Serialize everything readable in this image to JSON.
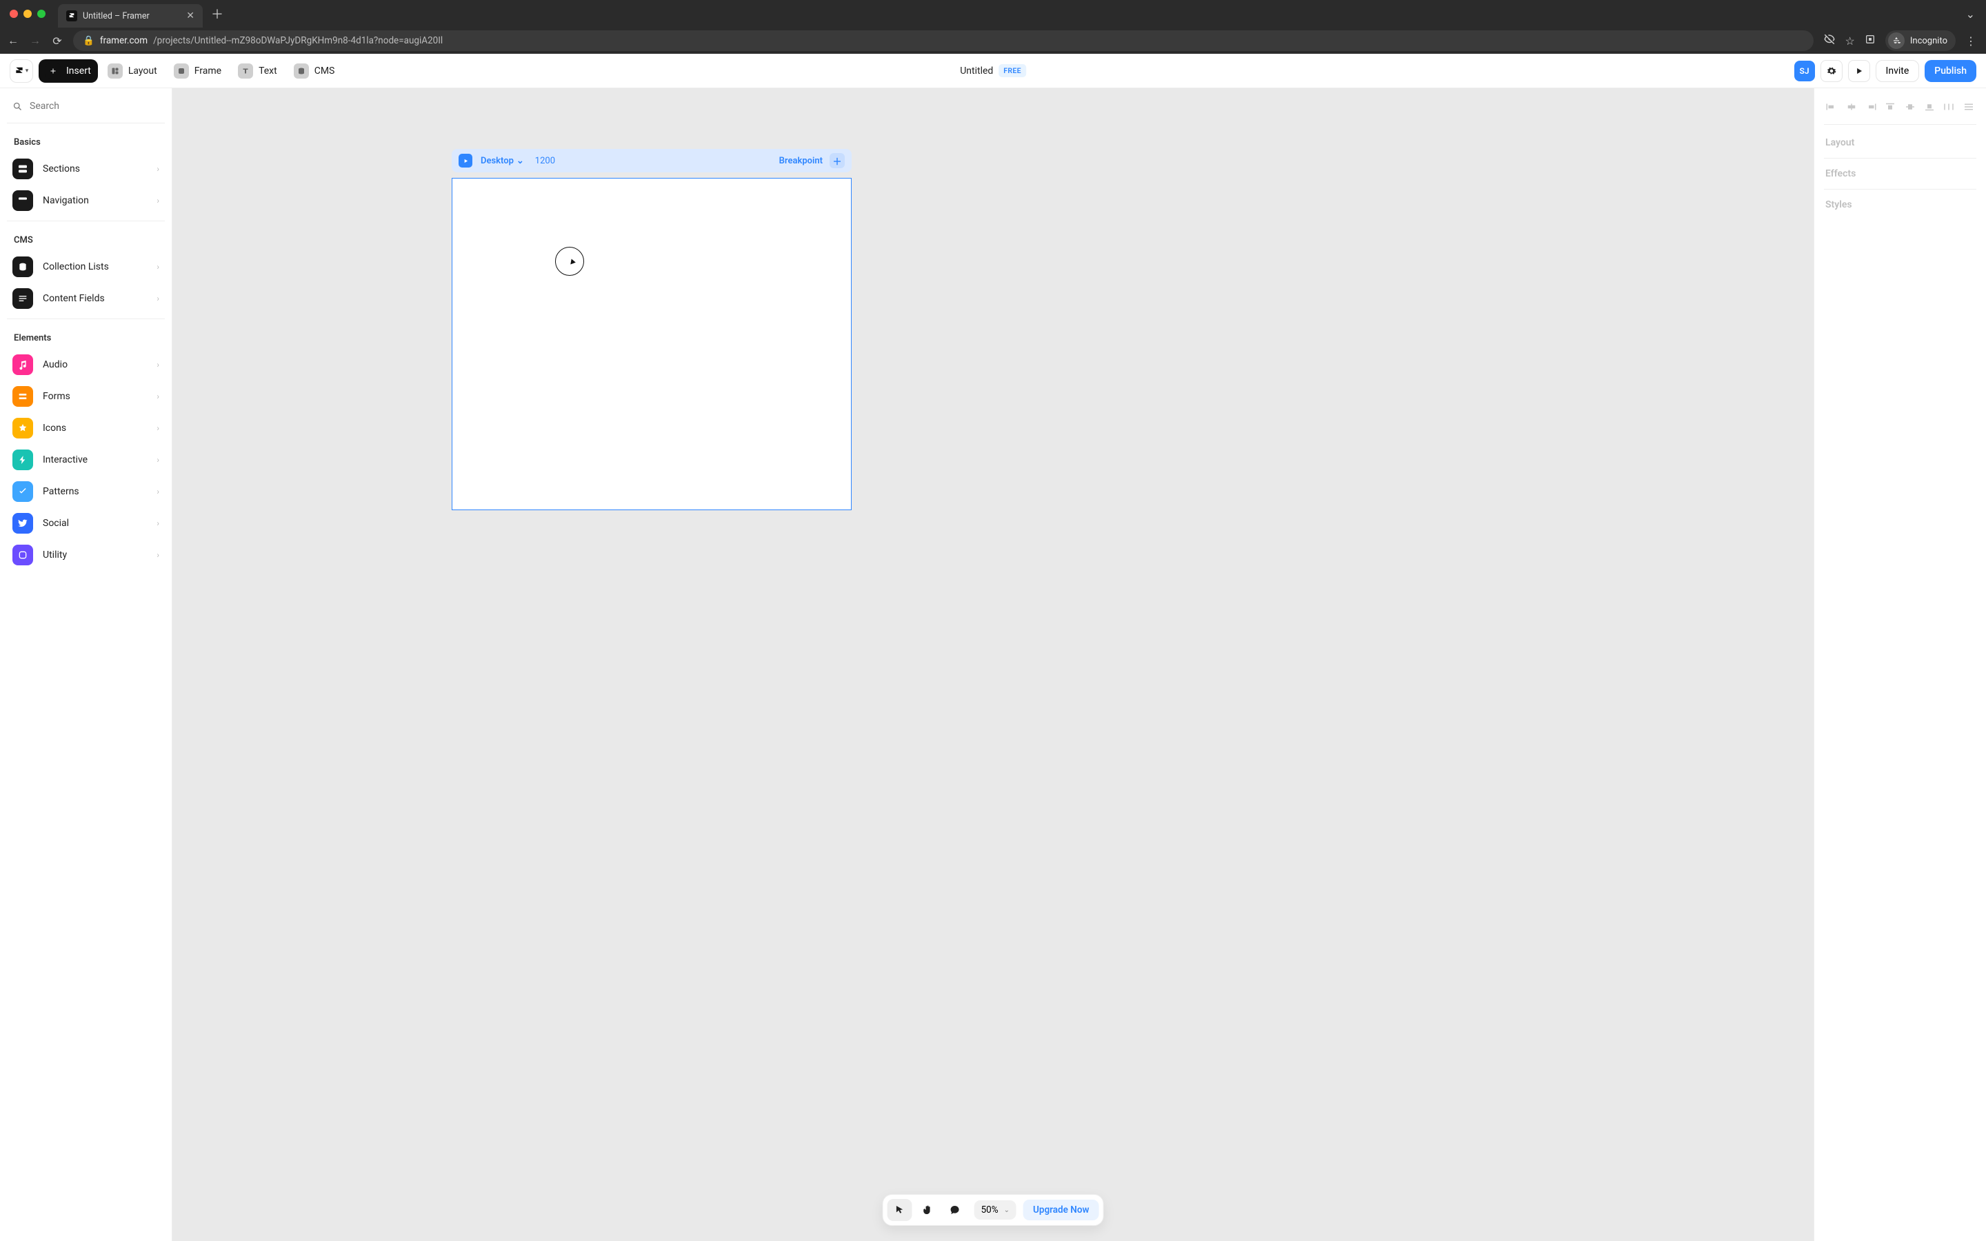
{
  "browser": {
    "tab_title": "Untitled – Framer",
    "url_domain": "framer.com",
    "url_path": "/projects/Untitled--mZ98oDWaPJyDRgKHm9n8-4d1la?node=augiA20Il",
    "incognito_label": "Incognito"
  },
  "toolbar": {
    "insert": "Insert",
    "layout": "Layout",
    "frame": "Frame",
    "text": "Text",
    "cms": "CMS",
    "project_title": "Untitled",
    "plan_badge": "FREE",
    "user_initials": "SJ",
    "invite": "Invite",
    "publish": "Publish"
  },
  "left": {
    "search_placeholder": "Search",
    "sections": {
      "basics": {
        "label": "Basics",
        "items": [
          "Sections",
          "Navigation"
        ]
      },
      "cms": {
        "label": "CMS",
        "items": [
          "Collection Lists",
          "Content Fields"
        ]
      },
      "elements": {
        "label": "Elements",
        "items": [
          "Audio",
          "Forms",
          "Icons",
          "Interactive",
          "Patterns",
          "Social",
          "Utility"
        ]
      }
    }
  },
  "canvas": {
    "breakpoint_name": "Desktop",
    "breakpoint_width": "1200",
    "breakpoint_label": "Breakpoint"
  },
  "floatbar": {
    "zoom": "50%",
    "upgrade": "Upgrade Now"
  },
  "right": {
    "layout": "Layout",
    "effects": "Effects",
    "styles": "Styles"
  },
  "colors": {
    "accent": "#2f86ff"
  }
}
